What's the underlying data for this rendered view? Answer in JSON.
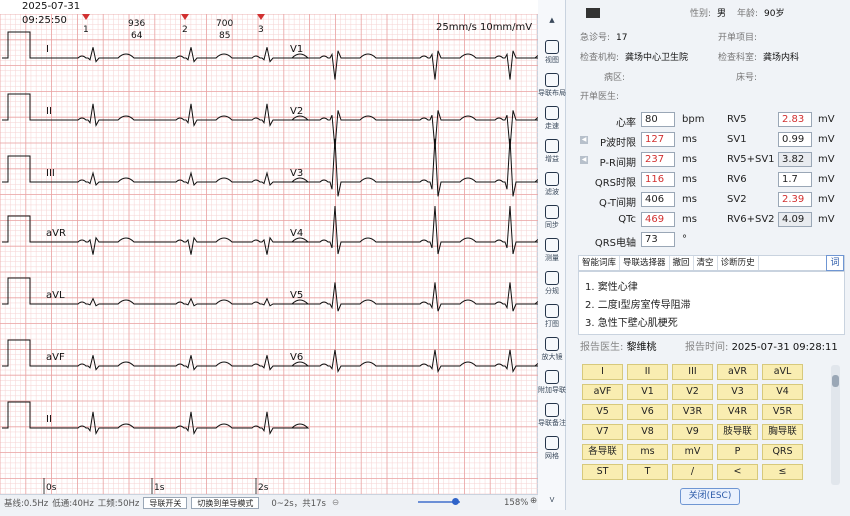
{
  "header": {
    "timestamp": "2025-07-31 09:25:50"
  },
  "ecg": {
    "speed_gain": "25mm/s 10mm/mV",
    "beat_markers": [
      {
        "num": "1",
        "hr": "",
        "val": ""
      },
      {
        "num": "2",
        "hr": "936",
        "val": "64"
      },
      {
        "num": "3",
        "hr": "700",
        "val": "85"
      }
    ],
    "left_leads": [
      "I",
      "II",
      "III",
      "aVR",
      "aVL",
      "aVF",
      "II"
    ],
    "right_leads": [
      "V1",
      "V2",
      "V3",
      "V4",
      "V5",
      "V6"
    ],
    "time_labels": [
      "0s",
      "1s",
      "2s"
    ]
  },
  "status": {
    "baseline": "基线:0.5Hz",
    "lowpass": "低通:40Hz",
    "powerline": "工频:50Hz",
    "lead_switch_btn": "导联开关",
    "single_lead_btn": "切换到单导模式",
    "range": "0~2s，共17s",
    "zoom": "158%",
    "zoom_fraction": 0.8
  },
  "toolbar": [
    {
      "label": "视图",
      "icon": "grid-view-icon"
    },
    {
      "label": "导联布局",
      "icon": "lead-layout-icon"
    },
    {
      "label": "走速",
      "icon": "speed-icon"
    },
    {
      "label": "增益",
      "icon": "gain-icon"
    },
    {
      "label": "滤波",
      "icon": "filter-icon"
    },
    {
      "label": "同步",
      "icon": "sync-icon"
    },
    {
      "label": "测量",
      "icon": "ruler-icon"
    },
    {
      "label": "分规",
      "icon": "caliper-icon"
    },
    {
      "label": "打图",
      "icon": "print-icon"
    },
    {
      "label": "放大镜",
      "icon": "magnifier-icon"
    },
    {
      "label": "附加导联",
      "icon": "add-lead-icon"
    },
    {
      "label": "导联备注",
      "icon": "note-icon"
    },
    {
      "label": "网格",
      "icon": "grid-icon"
    }
  ],
  "patient": {
    "gender_label": "性别:",
    "gender": "男",
    "age_label": "年龄:",
    "age": "90岁",
    "visit_label": "急诊号:",
    "visit": "17",
    "order_label": "开单项目:",
    "order": "",
    "org_label": "检查机构:",
    "org": "龚场中心卫生院",
    "dept_label": "检查科室:",
    "dept": "龚场内科",
    "ward_label": "病区:",
    "ward": "",
    "bed_label": "床号:",
    "bed": "",
    "doctor_label": "开单医生:",
    "doctor": ""
  },
  "measurements_left": [
    {
      "label": "心率",
      "value": "80",
      "unit": "bpm",
      "red": false
    },
    {
      "label": "P波时限",
      "value": "127",
      "unit": "ms",
      "red": true
    },
    {
      "label": "P-R间期",
      "value": "237",
      "unit": "ms",
      "red": true
    },
    {
      "label": "QRS时限",
      "value": "116",
      "unit": "ms",
      "red": true
    },
    {
      "label": "Q-T间期",
      "value": "406",
      "unit": "ms",
      "red": false
    },
    {
      "label": "QTc",
      "value": "469",
      "unit": "ms",
      "red": true
    },
    {
      "label": "QRS电轴",
      "value": "73",
      "unit": "°",
      "red": false
    }
  ],
  "measurements_right": [
    {
      "label": "RV5",
      "value": "2.83",
      "unit": "mV",
      "red": true,
      "grey": false
    },
    {
      "label": "SV1",
      "value": "0.99",
      "unit": "mV",
      "red": false,
      "grey": false
    },
    {
      "label": "RV5+SV1",
      "value": "3.82",
      "unit": "mV",
      "red": false,
      "grey": true
    },
    {
      "label": "RV6",
      "value": "1.7",
      "unit": "mV",
      "red": false,
      "grey": false
    },
    {
      "label": "SV2",
      "value": "2.39",
      "unit": "mV",
      "red": true,
      "grey": false
    },
    {
      "label": "RV6+SV2",
      "value": "4.09",
      "unit": "mV",
      "red": false,
      "grey": true
    }
  ],
  "diag_tabs": [
    "智能词库",
    "导联选择器",
    "撤回",
    "清空",
    "诊断历史"
  ],
  "diag_toggle": "词",
  "diagnoses": [
    "1.  窦性心律",
    "2.  二度Ⅰ型房室传导阻滞",
    "3.  急性下壁心肌梗死"
  ],
  "report": {
    "doctor_label": "报告医生:",
    "doctor": "黎维桃",
    "time_label": "报告时间:",
    "time": "2025-07-31 09:28:11"
  },
  "keyboard": [
    [
      "I",
      "II",
      "III",
      "aVR",
      "aVL"
    ],
    [
      "aVF",
      "V1",
      "V2",
      "V3",
      "V4"
    ],
    [
      "V5",
      "V6",
      "V3R",
      "V4R",
      "V5R"
    ],
    [
      "V7",
      "V8",
      "V9",
      "肢导联",
      "胸导联"
    ],
    [
      "各导联",
      "ms",
      "mV",
      "P",
      "QRS"
    ],
    [
      "ST",
      "T",
      "/",
      "<",
      "≤"
    ]
  ],
  "close_btn": "关闭(ESC)",
  "colors": {
    "grid_minor": "#f6d3d3",
    "grid_major": "#e9a3a3",
    "trace": "#111111",
    "accent": "#2f63c9",
    "warn": "#d13030"
  }
}
